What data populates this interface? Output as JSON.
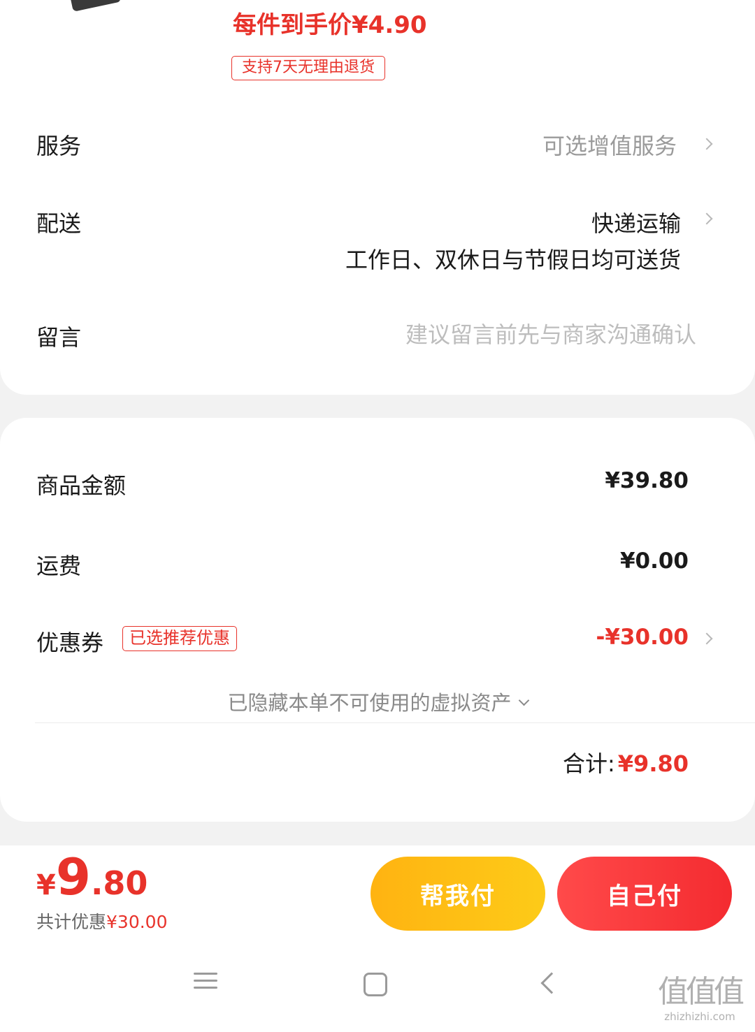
{
  "product": {
    "unit_price_label": "每件到手价¥4.90",
    "return_badge": "支持7天无理由退货"
  },
  "service": {
    "label": "服务",
    "value": "可选增值服务"
  },
  "delivery": {
    "label": "配送",
    "method": "快递运输",
    "note": "工作日、双休日与节假日均可送货"
  },
  "message": {
    "label": "留言",
    "placeholder": "建议留言前先与商家沟通确认"
  },
  "summary": {
    "goods_label": "商品金额",
    "goods_value": "¥39.80",
    "shipping_label": "运费",
    "shipping_value": "¥0.00",
    "coupon_label": "优惠券",
    "coupon_badge": "已选推荐优惠",
    "coupon_value": "-¥30.00",
    "hidden_assets": "已隐藏本单不可使用的虚拟资产",
    "total_label": "合计:",
    "total_value": "¥9.80"
  },
  "checkout": {
    "currency": "¥",
    "price_int": "9",
    "price_dec": ".80",
    "saving_label": "共计优惠",
    "saving_value": "¥30.00",
    "help_pay": "帮我付",
    "self_pay": "自己付"
  },
  "watermark": {
    "logo": "值值值",
    "url": "zhizhizhi.com"
  },
  "colors": {
    "accent": "#e8322a",
    "help_btn": "#fdbd15",
    "self_btn": "#f5333a"
  }
}
